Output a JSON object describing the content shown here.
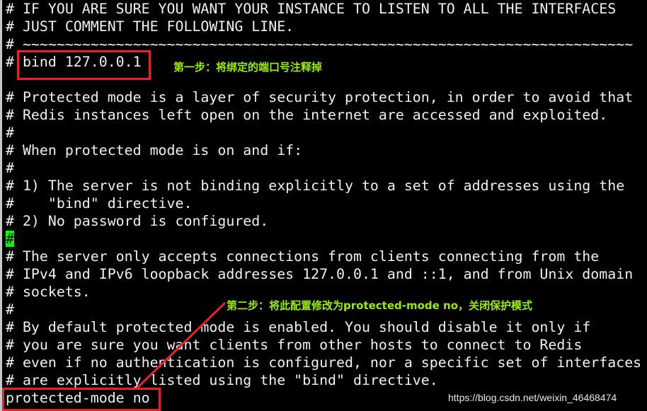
{
  "terminal": {
    "lines": [
      "# IF YOU ARE SURE YOU WANT YOUR INSTANCE TO LISTEN TO ALL THE INTERFACES",
      "# JUST COMMENT THE FOLLOWING LINE.",
      "# ~~~~~~~~~~~~~~~~~~~~~~~~~~~~~~~~~~~~~~~~~~~~~~~~~~~~~~~~~~~~~~~~~~~~~~~~",
      "# bind 127.0.0.1",
      "",
      "# Protected mode is a layer of security protection, in order to avoid that",
      "# Redis instances left open on the internet are accessed and exploited.",
      "#",
      "# When protected mode is on and if:",
      "#",
      "# 1) The server is not binding explicitly to a set of addresses using the",
      "#    \"bind\" directive.",
      "# 2) No password is configured.",
      "",
      "# The server only accepts connections from clients connecting from the",
      "# IPv4 and IPv6 loopback addresses 127.0.0.1 and ::1, and from Unix domain",
      "# sockets.",
      "#",
      "# By default protected mode is enabled. You should disable it only if",
      "# you are sure you want clients from other hosts to connect to Redis",
      "# even if no authentication is configured, nor a specific set of interfaces",
      "# are explicitly listed using the \"bind\" directive.",
      "protected-mode no"
    ],
    "cursor_char": "#"
  },
  "annotations": {
    "step1": "第一步：将绑定的端口号注释掉",
    "step2": "第二步：将此配置修改为protected-mode no，关闭保护模式"
  },
  "watermark": "https://blog.csdn.net/weixin_46468474",
  "colors": {
    "highlight": "#e8202a",
    "note": "#99ee00",
    "cursor": "#00ff00"
  }
}
